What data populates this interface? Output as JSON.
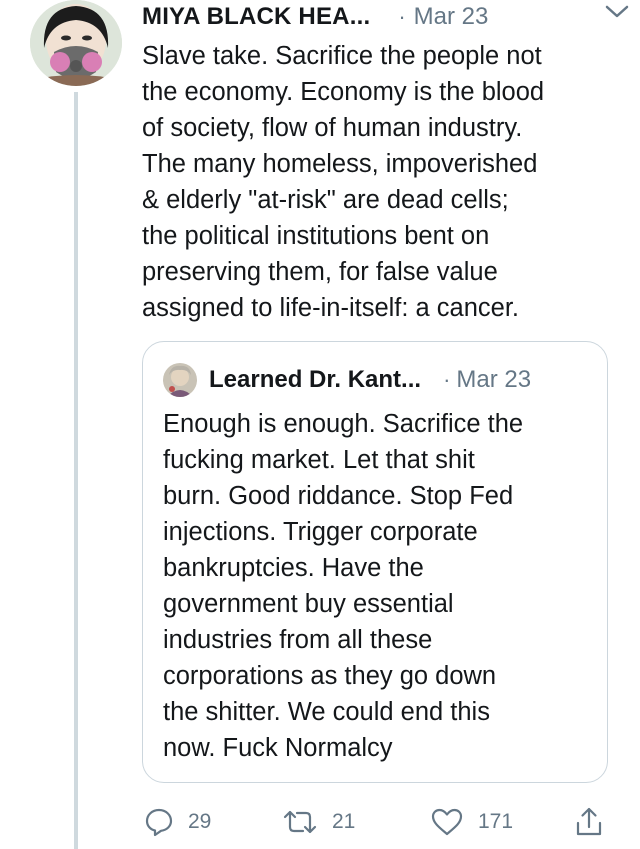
{
  "tweet": {
    "author_name": "MIYA BLACK HEA...",
    "separator": "·",
    "date": "Mar 23",
    "text": "Slave take. Sacrifice the people not\nthe economy. Economy is the blood\nof society, flow of human industry.\nThe many homeless, impoverished\n& elderly \"at-risk\" are dead cells;\nthe political institutions bent on\npreserving them, for false value\nassigned to life-in-itself: a cancer.",
    "quoted": {
      "author_name": "Learned Dr. Kant...",
      "separator": "·",
      "date": "Mar 23",
      "text": "Enough is enough. Sacrifice the\nfucking market. Let that shit\nburn. Good riddance. Stop Fed\ninjections. Trigger corporate\nbankruptcies. Have the\ngovernment buy essential\nindustries from all these\ncorporations as they go down\nthe shitter. We could  end this\nnow. Fuck Normalcy"
    },
    "actions": {
      "reply_count": "29",
      "retweet_count": "21",
      "like_count": "171"
    }
  },
  "icons": {
    "more": "chevron-down-icon",
    "reply": "reply-icon",
    "retweet": "retweet-icon",
    "like": "heart-icon",
    "share": "share-icon"
  },
  "colors": {
    "text": "#14171a",
    "secondary": "#657786",
    "border": "#ccd6dd",
    "thread_line": "#cfd9de"
  }
}
